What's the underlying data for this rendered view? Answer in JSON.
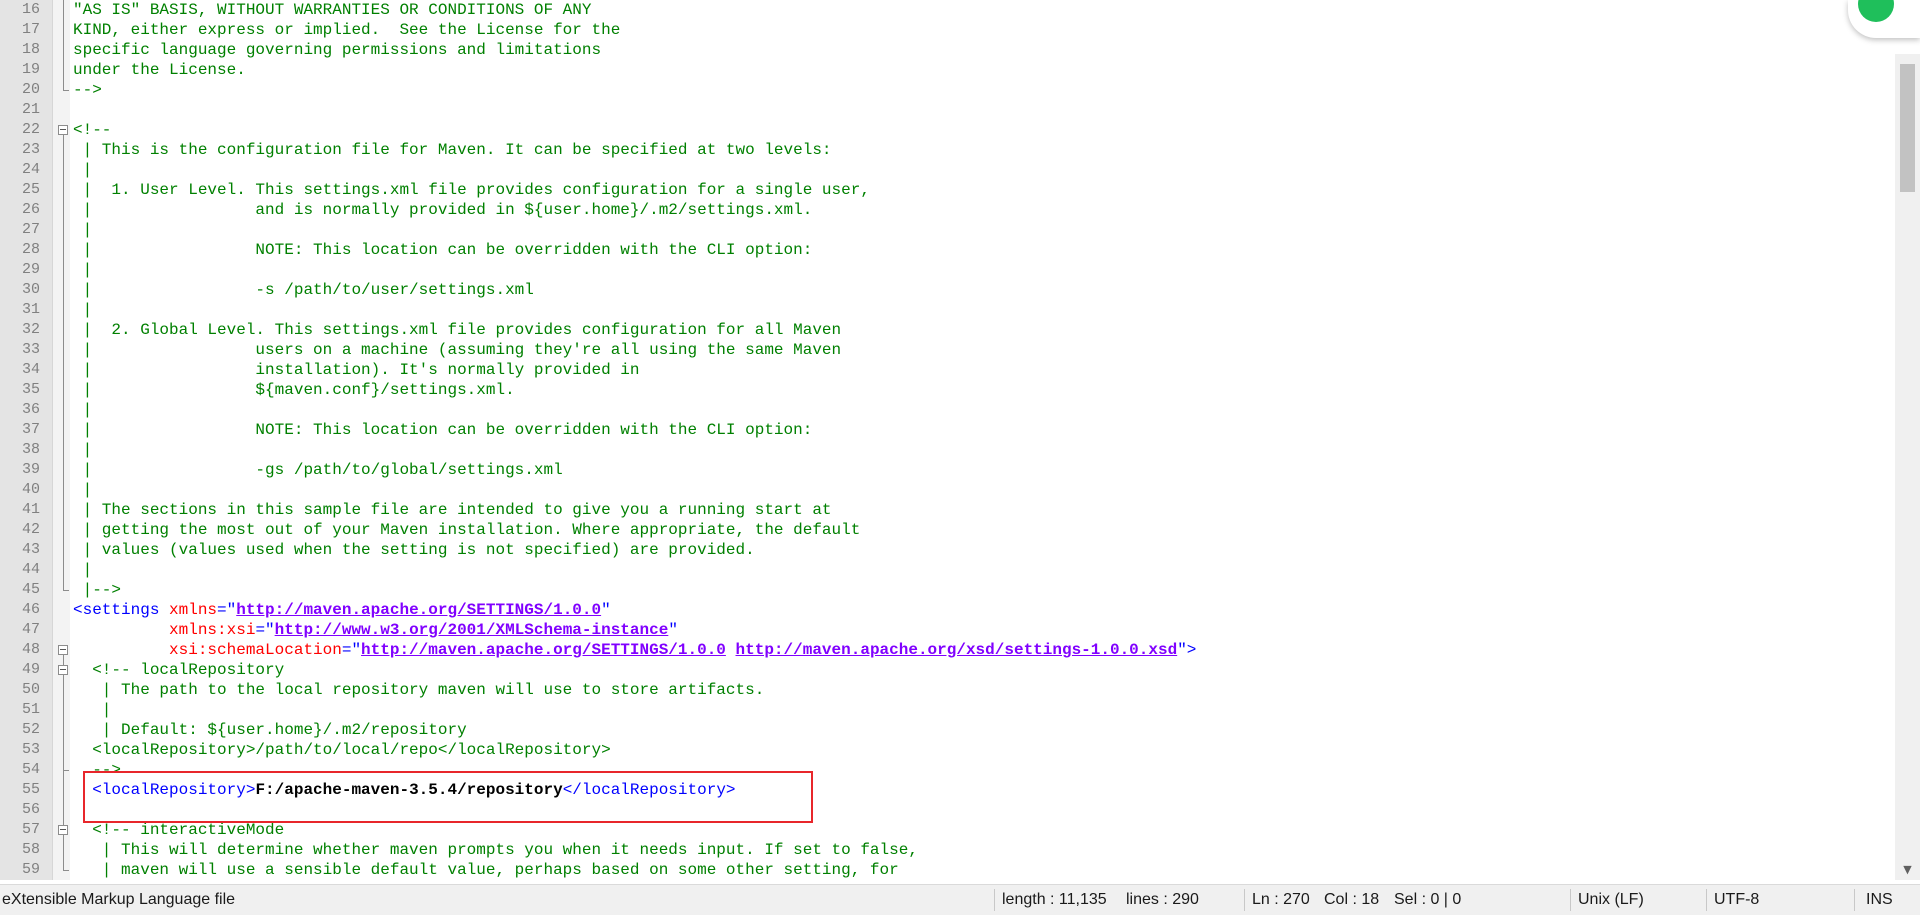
{
  "editor": {
    "lines": [
      {
        "n": "16",
        "segs": [
          [
            "c",
            "\"AS IS\" BASIS, WITHOUT WARRANTIES OR CONDITIONS OF ANY"
          ]
        ]
      },
      {
        "n": "17",
        "segs": [
          [
            "c",
            "KIND, either express or implied.  See the License for the"
          ]
        ]
      },
      {
        "n": "18",
        "segs": [
          [
            "c",
            "specific language governing permissions and limitations"
          ]
        ]
      },
      {
        "n": "19",
        "segs": [
          [
            "c",
            "under the License."
          ]
        ]
      },
      {
        "n": "20",
        "segs": [
          [
            "c",
            "-->"
          ]
        ]
      },
      {
        "n": "21",
        "segs": []
      },
      {
        "n": "22",
        "segs": [
          [
            "c",
            "<!--"
          ]
        ]
      },
      {
        "n": "23",
        "segs": [
          [
            "c",
            " | This is the configuration file for Maven. It can be specified at two levels:"
          ]
        ]
      },
      {
        "n": "24",
        "segs": [
          [
            "c",
            " |"
          ]
        ]
      },
      {
        "n": "25",
        "segs": [
          [
            "c",
            " |  1. User Level. This settings.xml file provides configuration for a single user,"
          ]
        ]
      },
      {
        "n": "26",
        "segs": [
          [
            "c",
            " |                 and is normally provided in ${user.home}/.m2/settings.xml."
          ]
        ]
      },
      {
        "n": "27",
        "segs": [
          [
            "c",
            " |"
          ]
        ]
      },
      {
        "n": "28",
        "segs": [
          [
            "c",
            " |                 NOTE: This location can be overridden with the CLI option:"
          ]
        ]
      },
      {
        "n": "29",
        "segs": [
          [
            "c",
            " |"
          ]
        ]
      },
      {
        "n": "30",
        "segs": [
          [
            "c",
            " |                 -s /path/to/user/settings.xml"
          ]
        ]
      },
      {
        "n": "31",
        "segs": [
          [
            "c",
            " |"
          ]
        ]
      },
      {
        "n": "32",
        "segs": [
          [
            "c",
            " |  2. Global Level. This settings.xml file provides configuration for all Maven"
          ]
        ]
      },
      {
        "n": "33",
        "segs": [
          [
            "c",
            " |                 users on a machine (assuming they're all using the same Maven"
          ]
        ]
      },
      {
        "n": "34",
        "segs": [
          [
            "c",
            " |                 installation). It's normally provided in"
          ]
        ]
      },
      {
        "n": "35",
        "segs": [
          [
            "c",
            " |                 ${maven.conf}/settings.xml."
          ]
        ]
      },
      {
        "n": "36",
        "segs": [
          [
            "c",
            " |"
          ]
        ]
      },
      {
        "n": "37",
        "segs": [
          [
            "c",
            " |                 NOTE: This location can be overridden with the CLI option:"
          ]
        ]
      },
      {
        "n": "38",
        "segs": [
          [
            "c",
            " |"
          ]
        ]
      },
      {
        "n": "39",
        "segs": [
          [
            "c",
            " |                 -gs /path/to/global/settings.xml"
          ]
        ]
      },
      {
        "n": "40",
        "segs": [
          [
            "c",
            " |"
          ]
        ]
      },
      {
        "n": "41",
        "segs": [
          [
            "c",
            " | The sections in this sample file are intended to give you a running start at"
          ]
        ]
      },
      {
        "n": "42",
        "segs": [
          [
            "c",
            " | getting the most out of your Maven installation. Where appropriate, the default"
          ]
        ]
      },
      {
        "n": "43",
        "segs": [
          [
            "c",
            " | values (values used when the setting is not specified) are provided."
          ]
        ]
      },
      {
        "n": "44",
        "segs": [
          [
            "c",
            " |"
          ]
        ]
      },
      {
        "n": "45",
        "segs": [
          [
            "c",
            " |-->"
          ]
        ]
      },
      {
        "n": "46",
        "segs": [
          [
            "tag",
            "<settings "
          ],
          [
            "attr",
            "xmlns"
          ],
          [
            "tag",
            "=\""
          ],
          [
            "val",
            "http://maven.apache.org/SETTINGS/1.0.0"
          ],
          [
            "tag",
            "\""
          ]
        ]
      },
      {
        "n": "47",
        "segs": [
          [
            "tag",
            "          "
          ],
          [
            "attr",
            "xmlns:xsi"
          ],
          [
            "tag",
            "=\""
          ],
          [
            "val",
            "http://www.w3.org/2001/XMLSchema-instance"
          ],
          [
            "tag",
            "\""
          ]
        ]
      },
      {
        "n": "48",
        "segs": [
          [
            "tag",
            "          "
          ],
          [
            "attr",
            "xsi:schemaLocation"
          ],
          [
            "tag",
            "=\""
          ],
          [
            "val",
            "http://maven.apache.org/SETTINGS/1.0.0"
          ],
          [
            "tag",
            " "
          ],
          [
            "val",
            "http://maven.apache.org/xsd/settings-1.0.0.xsd"
          ],
          [
            "tag",
            "\">"
          ]
        ]
      },
      {
        "n": "49",
        "segs": [
          [
            "c",
            "  <!-- localRepository"
          ]
        ]
      },
      {
        "n": "50",
        "segs": [
          [
            "c",
            "   | The path to the local repository maven will use to store artifacts."
          ]
        ]
      },
      {
        "n": "51",
        "segs": [
          [
            "c",
            "   |"
          ]
        ]
      },
      {
        "n": "52",
        "segs": [
          [
            "c",
            "   | Default: ${user.home}/.m2/repository"
          ]
        ]
      },
      {
        "n": "53",
        "segs": [
          [
            "c",
            "  <localRepository>/path/to/local/repo</localRepository>"
          ]
        ]
      },
      {
        "n": "54",
        "segs": [
          [
            "c",
            "  -->"
          ]
        ]
      },
      {
        "n": "55",
        "segs": [
          [
            "tag",
            "  <localRepository>"
          ],
          [
            "txt",
            "F:/apache-maven-3.5.4/repository"
          ],
          [
            "tag",
            "</localRepository>"
          ]
        ]
      },
      {
        "n": "56",
        "segs": []
      },
      {
        "n": "57",
        "segs": [
          [
            "c",
            "  <!-- interactiveMode"
          ]
        ]
      },
      {
        "n": "58",
        "segs": [
          [
            "c",
            "   | This will determine whether maven prompts you when it needs input. If set to false,"
          ]
        ]
      },
      {
        "n": "59",
        "segs": [
          [
            "c",
            "   | maven will use a sensible default value, perhaps based on some other setting, for"
          ]
        ]
      }
    ]
  },
  "statusbar": {
    "file_type": "eXtensible Markup Language file",
    "length": "length : 11,135",
    "lines": "lines : 290",
    "ln": "Ln : 270",
    "col": "Col : 18",
    "sel": "Sel : 0 | 0",
    "eol": "Unix (LF)",
    "encoding": "UTF-8",
    "mode": "INS"
  }
}
